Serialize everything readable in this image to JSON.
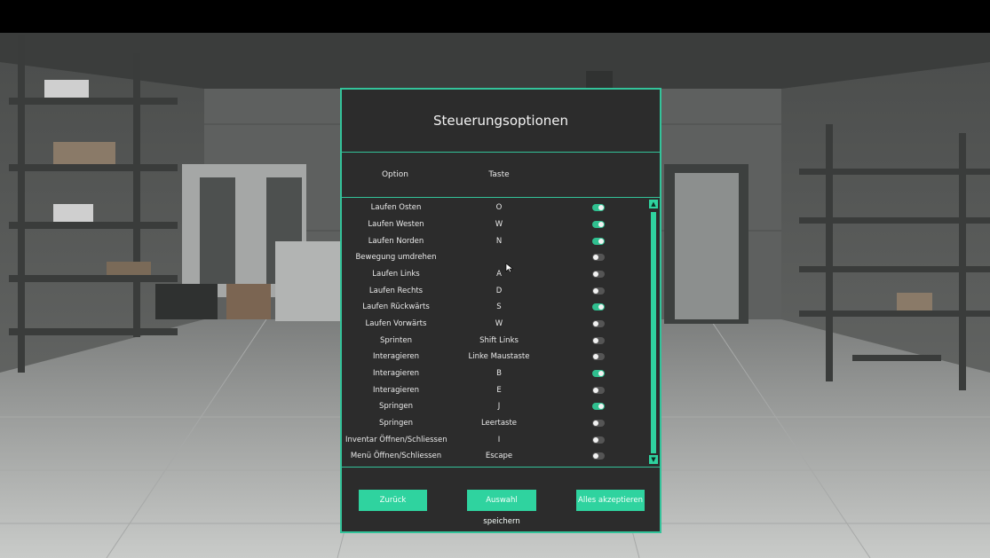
{
  "menu": {
    "title": "Steuerungsoptionen",
    "col_option": "Option",
    "col_key": "Taste",
    "rows": [
      {
        "option": "Laufen Osten",
        "key": "O",
        "enabled": true
      },
      {
        "option": "Laufen Westen",
        "key": "W",
        "enabled": true
      },
      {
        "option": "Laufen Norden",
        "key": "N",
        "enabled": true
      },
      {
        "option": "Bewegung umdrehen",
        "key": "",
        "enabled": false
      },
      {
        "option": "Laufen Links",
        "key": "A",
        "enabled": false
      },
      {
        "option": "Laufen Rechts",
        "key": "D",
        "enabled": false
      },
      {
        "option": "Laufen Rückwärts",
        "key": "S",
        "enabled": true
      },
      {
        "option": "Laufen Vorwärts",
        "key": "W",
        "enabled": false
      },
      {
        "option": "Sprinten",
        "key": "Shift Links",
        "enabled": false
      },
      {
        "option": "Interagieren",
        "key": "Linke Maustaste",
        "enabled": false
      },
      {
        "option": "Interagieren",
        "key": "B",
        "enabled": true
      },
      {
        "option": "Interagieren",
        "key": "E",
        "enabled": false
      },
      {
        "option": "Springen",
        "key": "J",
        "enabled": true
      },
      {
        "option": "Springen",
        "key": "Leertaste",
        "enabled": false
      },
      {
        "option": "Inventar Öffnen/Schliessen",
        "key": "I",
        "enabled": false
      },
      {
        "option": "Menü Öffnen/Schliessen",
        "key": "Escape",
        "enabled": false
      }
    ],
    "buttons": {
      "back": "Zurück",
      "save": "Auswahl speichern",
      "accept_all": "Alles akzeptieren"
    },
    "scroll_up_icon": "triangle-up",
    "scroll_down_icon": "triangle-down"
  },
  "colors": {
    "accent": "#2fd39f",
    "panel": "#2c2c2c",
    "toggle_off": "#555555"
  }
}
